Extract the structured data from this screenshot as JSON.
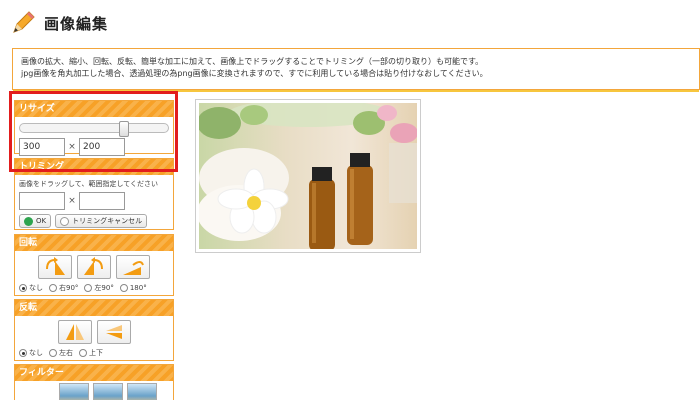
{
  "page": {
    "title": "画像編集"
  },
  "description": {
    "line1": "画像の拡大、縮小、回転、反転、簡単な加工に加えて、画像上でドラッグすることでトリミング（一部の切り取り）も可能です。",
    "line2": "jpg画像を角丸加工した場合、透過処理の為png画像に変換されますので、すでに利用している場合は貼り付けなおしてください。"
  },
  "resize": {
    "header": "リサイズ",
    "width_value": "300",
    "height_value": "200",
    "times": "×",
    "slider_level_pct": 72
  },
  "trim": {
    "header": "トリミング",
    "note": "画像をドラッグして、範囲指定してください",
    "times": "×",
    "ok_label": "OK",
    "cancel_label": "トリミングキャンセル"
  },
  "rotate": {
    "header": "回転",
    "options": [
      "なし",
      "右90°",
      "左90°",
      "180°"
    ],
    "selected": 0
  },
  "flip": {
    "header": "反転",
    "options": [
      "なし",
      "左右",
      "上下"
    ],
    "selected": 0
  },
  "filter": {
    "header": "フィルター"
  },
  "colors": {
    "accent": "#f7a127",
    "border": "#f3a63b",
    "highlight": "#e21d1d",
    "ok_green": "#2ea44f"
  }
}
